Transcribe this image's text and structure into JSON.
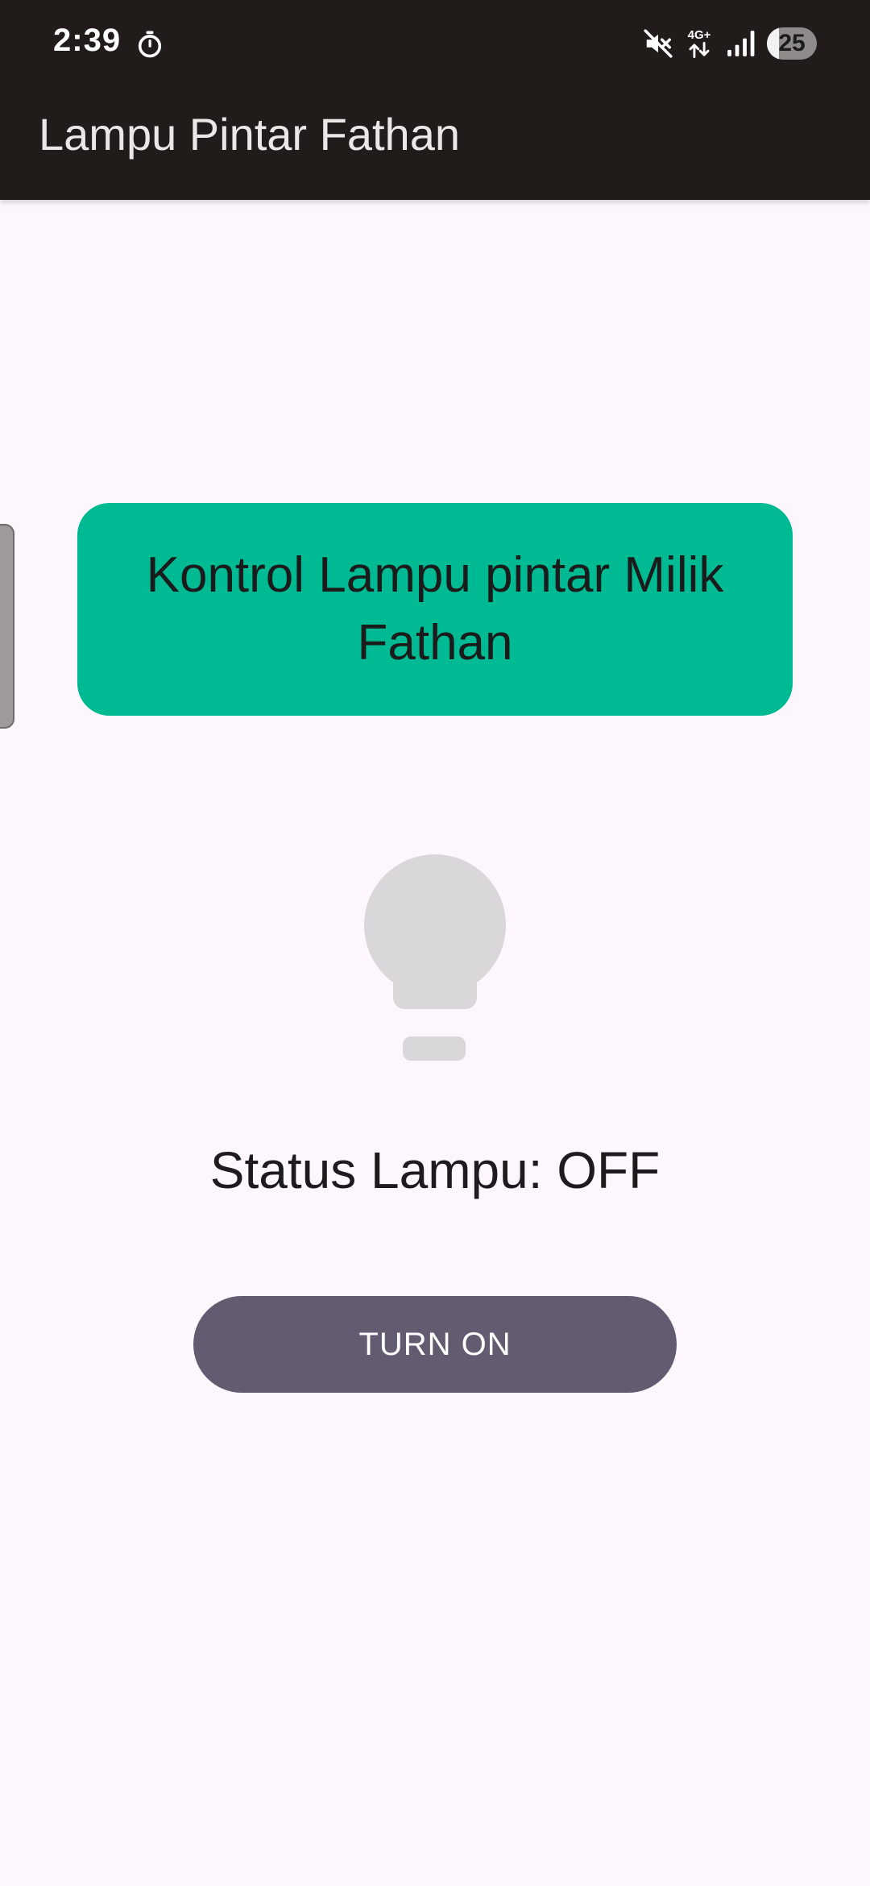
{
  "status_bar": {
    "time": "2:39",
    "timer_icon": "timer-icon",
    "mute_icon": "mute-icon",
    "network_label": "4G+",
    "signal_icon": "signal-icon",
    "battery_level": "25"
  },
  "app_bar": {
    "title": "Lampu Pintar Fathan",
    "background": "#211b1a"
  },
  "main": {
    "card_title": "Kontrol Lampu pintar Milik Fathan",
    "card_color": "#00ba94",
    "bulb_icon": "lightbulb-icon",
    "bulb_color": "#dad7db",
    "status_text": "Status Lampu: OFF",
    "toggle_button_label": "TURN ON",
    "button_color": "#635b70"
  }
}
